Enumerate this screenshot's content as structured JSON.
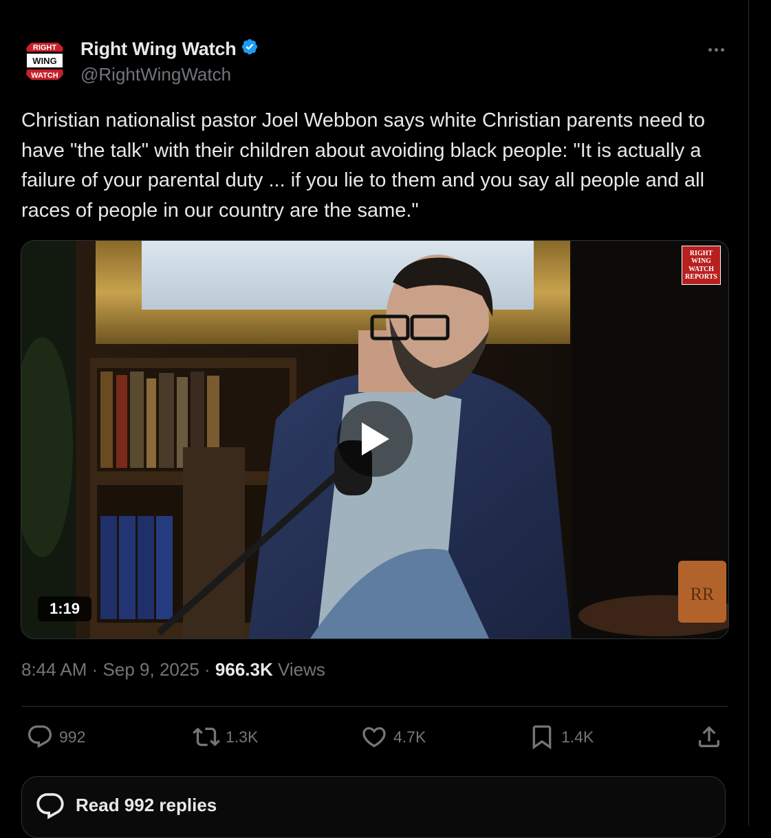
{
  "tweet": {
    "author": {
      "name": "Right Wing Watch",
      "handle": "@RightWingWatch",
      "verified": true,
      "verified_icon": "verified-badge-icon",
      "avatar_text": [
        "RIGHT",
        "WING",
        "WATCH"
      ]
    },
    "more_icon": "more-dots-icon",
    "text": "Christian nationalist pastor Joel Webbon says white Christian parents need to have \"the talk\" with their children about avoiding black people: \"It is actually a failure of your parental duty ... if you lie to them and you say all people and all races of people in our country are the same.\"",
    "media": {
      "type": "video",
      "duration": "1:19",
      "play_icon": "play-icon",
      "watermark": [
        "RIGHT",
        "WING",
        "WATCH",
        "REPORTS"
      ],
      "mug_logo": "RR"
    },
    "meta": {
      "time": "8:44 AM",
      "separator": "·",
      "date": "Sep 9, 2025",
      "views_count": "966.3K",
      "views_label": "Views"
    },
    "actions": {
      "replies": {
        "icon": "reply-icon",
        "count": "992"
      },
      "reposts": {
        "icon": "repost-icon",
        "count": "1.3K"
      },
      "likes": {
        "icon": "heart-icon",
        "count": "4.7K"
      },
      "bookmarks": {
        "icon": "bookmark-icon",
        "count": "1.4K"
      },
      "share": {
        "icon": "share-icon"
      }
    },
    "read_replies": {
      "icon": "reply-bubble-icon",
      "label": "Read 992 replies"
    }
  },
  "colors": {
    "background": "#000000",
    "text_primary": "#e7e9ea",
    "text_secondary": "#71767b",
    "border": "#2f3336",
    "verified_blue": "#1d9bf0",
    "rww_red": "#b8201f"
  }
}
